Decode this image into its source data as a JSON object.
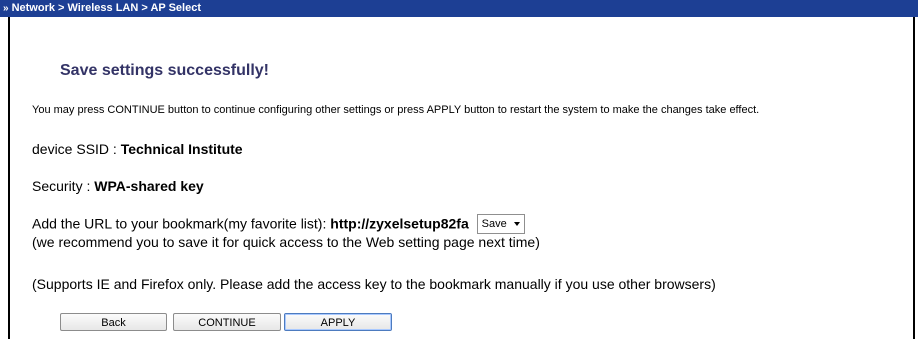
{
  "breadcrumb": {
    "arrow": "»",
    "path": "Network > Wireless LAN > AP Select"
  },
  "main": {
    "title": "Save settings successfully!",
    "instruction": "You may press CONTINUE button to continue configuring other settings or press APPLY button to restart the system to make the changes take effect.",
    "ssid_label": "device SSID : ",
    "ssid_value": "Technical Institute",
    "security_label": "Security : ",
    "security_value": "WPA-shared key",
    "bookmark_label": "Add the URL to your bookmark(my favorite list): ",
    "bookmark_url": "http://zyxelsetup82fa",
    "save_option": "Save",
    "recommend_text": "(we recommend you to save it for quick access to the Web setting page next time)",
    "support_text": "(Supports IE and Firefox only. Please add the access key to the bookmark manually if you use other browsers)"
  },
  "buttons": {
    "back": "Back",
    "continue": "CONTINUE",
    "apply": "APPLY"
  },
  "colors": {
    "header_bg": "#1d3f94",
    "title": "#333366"
  },
  "icons": {
    "breadcrumb": "double-chevron-right-icon",
    "dropdown": "chevron-down-icon"
  }
}
